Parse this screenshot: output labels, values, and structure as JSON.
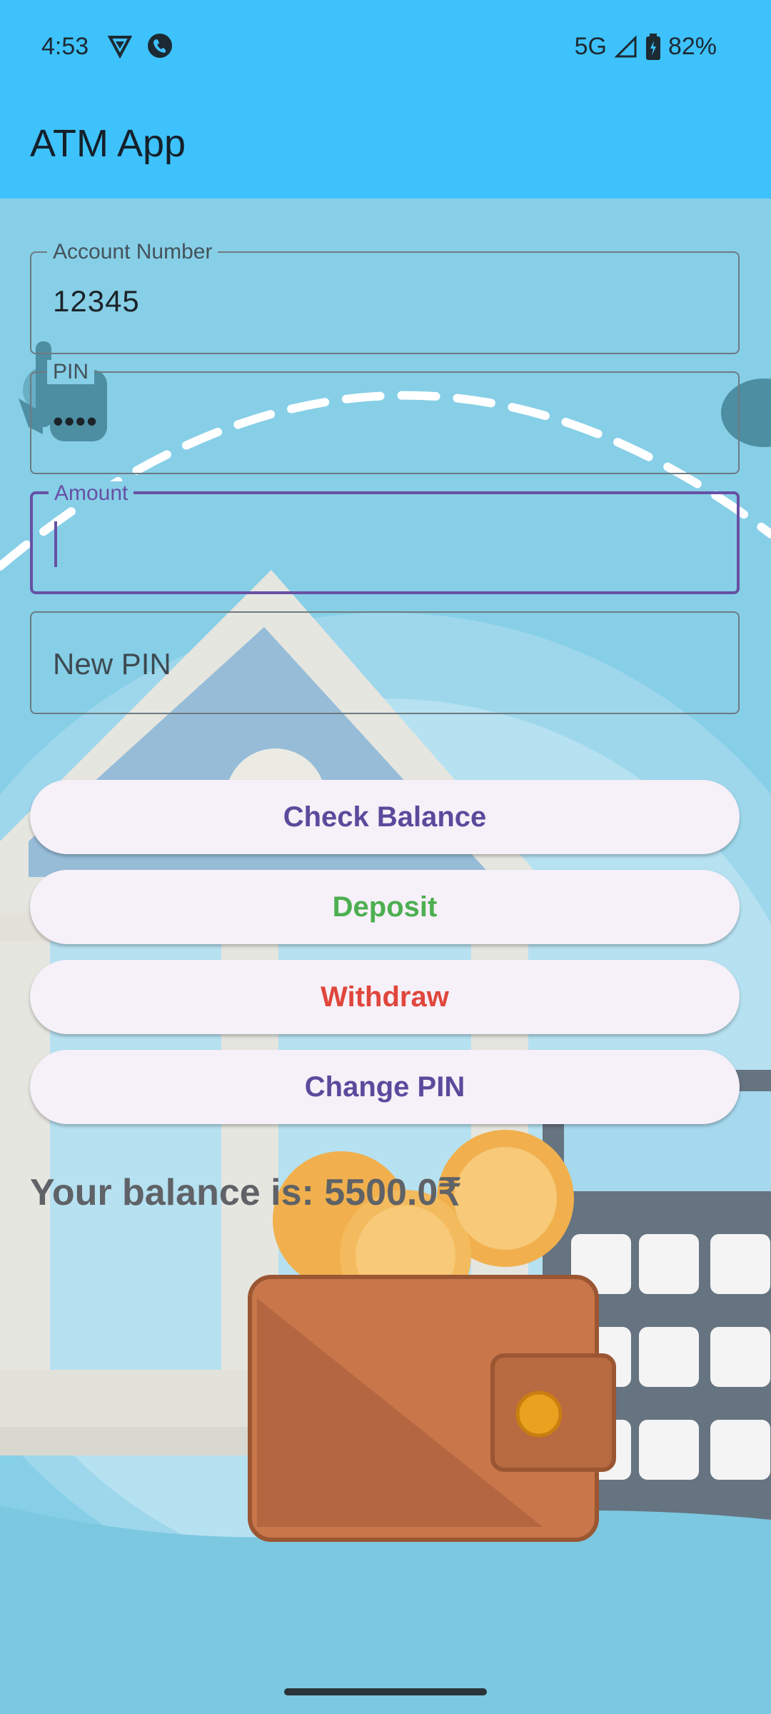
{
  "status_bar": {
    "time": "4:53",
    "network": "5G",
    "battery": "82%"
  },
  "app_bar": {
    "title": "ATM App"
  },
  "form": {
    "account_number": {
      "label": "Account Number",
      "value": "12345"
    },
    "pin": {
      "label": "PIN",
      "value": "••••"
    },
    "amount": {
      "label": "Amount",
      "value": ""
    },
    "new_pin": {
      "placeholder": "New PIN"
    }
  },
  "buttons": {
    "check_balance": {
      "label": "Check Balance",
      "color": "#5b4a9c"
    },
    "deposit": {
      "label": "Deposit",
      "color": "#4caf50"
    },
    "withdraw": {
      "label": "Withdraw",
      "color": "#e0463c"
    },
    "change_pin": {
      "label": "Change PIN",
      "color": "#5b4a9c"
    }
  },
  "balance_text": "Your balance is: 5500.0₹",
  "colors": {
    "app_bar": "#3ec2fc",
    "background": "#7fcde6",
    "focus": "#6750a4"
  }
}
